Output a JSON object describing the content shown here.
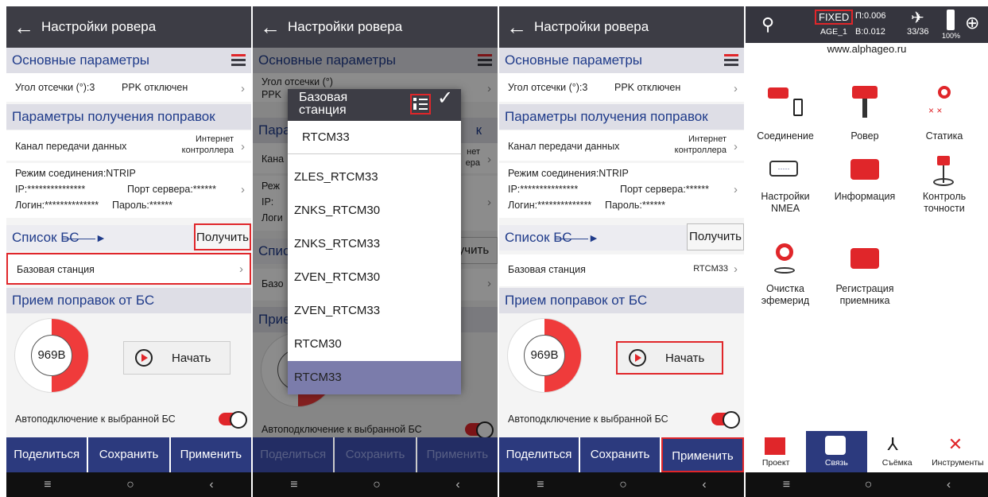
{
  "settings": {
    "title": "Настройки ровера",
    "main_params": "Основные параметры",
    "cutoff": "Угол отсечки (°):3",
    "ppk": "PPK отключен",
    "corr_params": "Параметры получения поправок",
    "channel_label": "Канал передачи данных",
    "channel_value_1": "Интернет",
    "channel_value_2": "контроллера",
    "mode": "Режим соединения:NTRIP",
    "ip": "IP:***************",
    "port": "Порт сервера:******",
    "login": "Логин:**************",
    "password": "Пароль:******",
    "bs_list": "Список БС",
    "get": "Получить",
    "base_station": "Базовая станция",
    "base_value": "RTCM33",
    "receive": "Прием поправок от БС",
    "voltage": "969B",
    "start": "Начать",
    "auto": "Автоподключение к выбранной БС",
    "share": "Поделиться",
    "save": "Сохранить",
    "apply": "Применить"
  },
  "panel2": {
    "cutoff": "Угол отсечки (°)",
    "ppk": "PPK",
    "corr_frag": "Пара",
    "corr_frag_r": "к",
    "channel_frag": "Кана",
    "channel_val_frag1": "нет",
    "channel_val_frag2": "ера",
    "mode_frag": "Реж",
    "ip_frag": "IP:",
    "login_frag": "Логи",
    "bs_frag": "Спис",
    "get_frag": "учить",
    "base_frag": "Базо",
    "receive_frag": "Прие"
  },
  "popup": {
    "title_1": "Базовая",
    "title_2": "станция",
    "selected": "RTCM33",
    "items": [
      "ZLES_RTCM33",
      "ZNKS_RTCM30",
      "ZNKS_RTCM33",
      "ZVEN_RTCM30",
      "ZVEN_RTCM33",
      "RTCM30",
      "RTCM33"
    ]
  },
  "status": {
    "fix": "FIXED",
    "age": "AGE_1",
    "p": "П:0.006",
    "b": "В:0.012",
    "sats": "33/36",
    "battery": "100%",
    "site": "www.alphageo.ru"
  },
  "menu": {
    "connection": "Соединение",
    "rover": "Ровер",
    "static": "Статика",
    "nmea_1": "Настройки",
    "nmea_2": "NMEA",
    "info": "Информация",
    "acc_1": "Контроль",
    "acc_2": "точности",
    "eph_1": "Очистка",
    "eph_2": "эфемерид",
    "reg_1": "Регистрация",
    "reg_2": "приемника"
  },
  "tabs": {
    "project": "Проект",
    "link": "Связь",
    "survey": "Съёмка",
    "tools": "Инструменты"
  },
  "nav": {
    "menu": "≡",
    "home": "○",
    "back": "‹"
  },
  "colors": {
    "accent": "#2c3a7e",
    "red": "#e0262a",
    "header": "#3d3d45"
  }
}
